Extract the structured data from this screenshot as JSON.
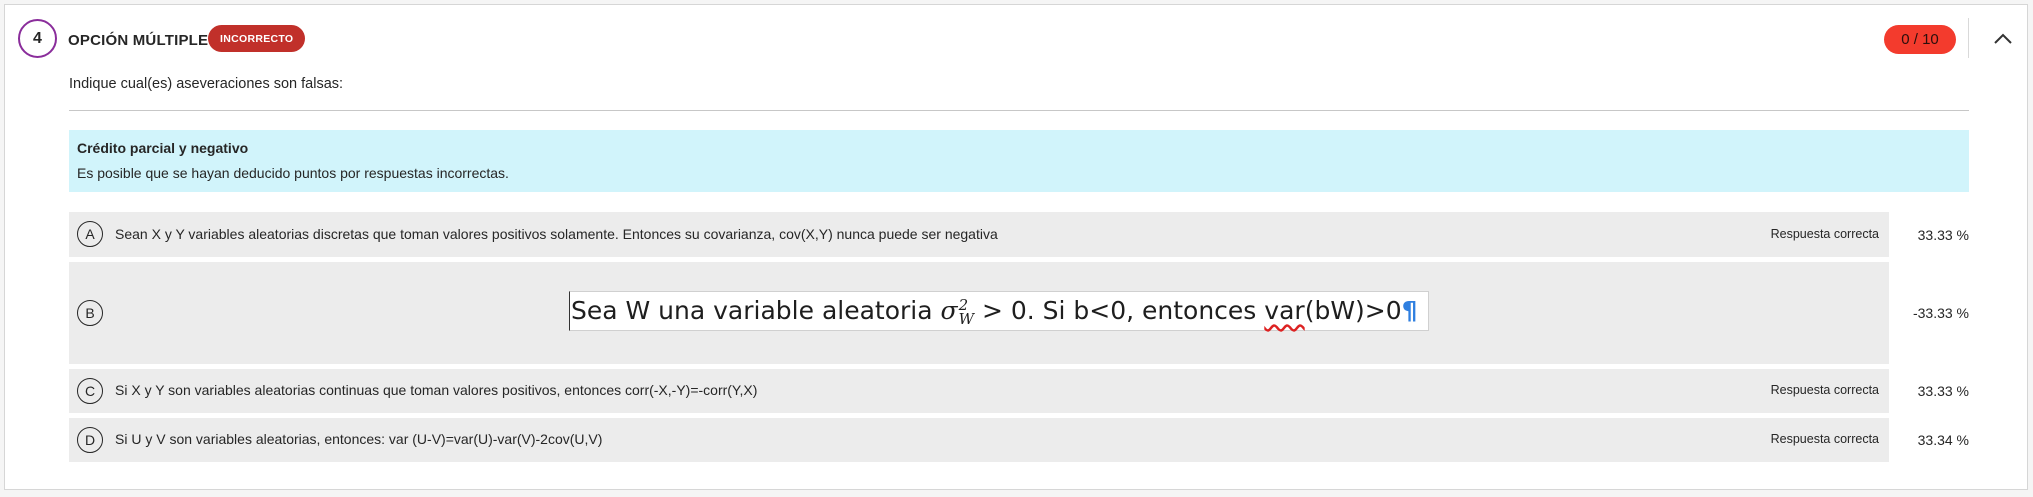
{
  "question": {
    "number": "4",
    "type": "OPCIÓN MÚLTIPLE",
    "status": "INCORRECTO",
    "score": "0 / 10",
    "prompt": "Indique cual(es) aseveraciones son falsas:"
  },
  "notice": {
    "title": "Crédito parcial y negativo",
    "text": "Es posible que se hayan deducido puntos por respuestas incorrectas."
  },
  "options": [
    {
      "letter": "A",
      "text": "Sean X y Y variables aleatorias discretas que toman valores positivos solamente. Entonces su covarianza, cov(X,Y) nunca puede ser negativa",
      "correct_label": "Respuesta correcta",
      "percent": "33.33 %"
    },
    {
      "letter": "B",
      "formula_part1": "Sea W una variable aleatoria ",
      "formula_sigma": "σ",
      "formula_sup": "2",
      "formula_sub": "W",
      "formula_part2": " > 0. Si b<0, entonces ",
      "formula_var": "var",
      "formula_part3": "(bW)>0",
      "formula_mark": "¶",
      "percent": "-33.33 %"
    },
    {
      "letter": "C",
      "text": "Si X y Y son variables aleatorias continuas que toman valores positivos, entonces corr(-X,-Y)=-corr(Y,X)",
      "correct_label": "Respuesta correcta",
      "percent": "33.33 %"
    },
    {
      "letter": "D",
      "text": "Si U y V son variables aleatorias, entonces: var (U-V)=var(U)-var(V)-2cov(U,V)",
      "correct_label": "Respuesta correcta",
      "percent": "33.34 %"
    }
  ],
  "colors": {
    "badge": "#c1302a",
    "score": "#f33b2d",
    "notice_bg": "#d1f4fb",
    "option_bg": "#ececec",
    "question_ring": "#8a2d9b"
  },
  "icons": {
    "collapse": "chevron-up-icon"
  }
}
